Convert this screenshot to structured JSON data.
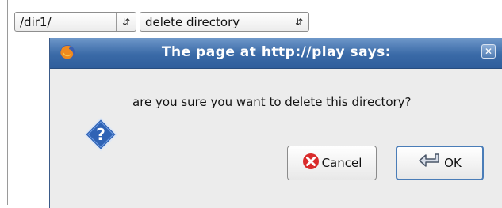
{
  "selects": {
    "directory": {
      "value": "/dir1/"
    },
    "action": {
      "value": "delete directory"
    }
  },
  "dialog": {
    "title": "The page at http://play says:",
    "message": "are you sure you want to delete this directory?",
    "cancel_label": "Cancel",
    "ok_label": "OK"
  },
  "icons": {
    "browser": "firefox-icon",
    "close": "close-icon",
    "question": "question-icon",
    "cancel": "cancel-icon",
    "ok": "return-arrow-icon"
  },
  "colors": {
    "titlebar": "#3a6aa7",
    "dialog_bg": "#ececec",
    "cancel_icon": "#d92b2b",
    "question_icon": "#2f63b5"
  }
}
